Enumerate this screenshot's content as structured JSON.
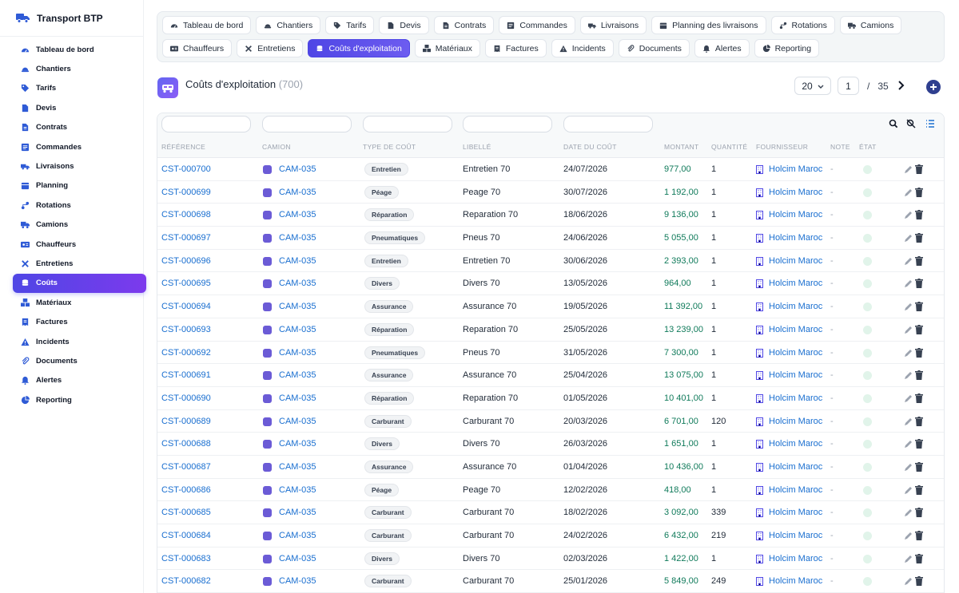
{
  "brand": {
    "title": "Transport BTP"
  },
  "sidebar": {
    "items": [
      {
        "label": "Tableau de bord",
        "icon": "gauge-icon"
      },
      {
        "label": "Chantiers",
        "icon": "hardhat-icon"
      },
      {
        "label": "Tarifs",
        "icon": "tag-icon"
      },
      {
        "label": "Devis",
        "icon": "document-icon"
      },
      {
        "label": "Contrats",
        "icon": "contract-icon"
      },
      {
        "label": "Commandes",
        "icon": "list-icon"
      },
      {
        "label": "Livraisons",
        "icon": "delivery-icon"
      },
      {
        "label": "Planning",
        "icon": "calendar-icon"
      },
      {
        "label": "Rotations",
        "icon": "route-icon"
      },
      {
        "label": "Camions",
        "icon": "truck-icon"
      },
      {
        "label": "Chauffeurs",
        "icon": "id-card-icon"
      },
      {
        "label": "Entretiens",
        "icon": "tools-icon"
      },
      {
        "label": "Coûts",
        "icon": "coins-icon",
        "active": true
      },
      {
        "label": "Matériaux",
        "icon": "cubes-icon"
      },
      {
        "label": "Factures",
        "icon": "invoice-icon"
      },
      {
        "label": "Incidents",
        "icon": "warning-icon"
      },
      {
        "label": "Documents",
        "icon": "paperclip-icon"
      },
      {
        "label": "Alertes",
        "icon": "bell-icon"
      },
      {
        "label": "Reporting",
        "icon": "pie-chart-icon"
      }
    ]
  },
  "tabs": [
    {
      "label": "Tableau de bord",
      "icon": "gauge-icon"
    },
    {
      "label": "Chantiers",
      "icon": "hardhat-icon"
    },
    {
      "label": "Tarifs",
      "icon": "tag-icon"
    },
    {
      "label": "Devis",
      "icon": "document-icon"
    },
    {
      "label": "Contrats",
      "icon": "contract-icon"
    },
    {
      "label": "Commandes",
      "icon": "list-icon"
    },
    {
      "label": "Livraisons",
      "icon": "delivery-icon"
    },
    {
      "label": "Planning des livraisons",
      "icon": "calendar-icon"
    },
    {
      "label": "Rotations",
      "icon": "route-icon"
    },
    {
      "label": "Camions",
      "icon": "truck-icon"
    },
    {
      "label": "Chauffeurs",
      "icon": "id-card-icon"
    },
    {
      "label": "Entretiens",
      "icon": "tools-icon"
    },
    {
      "label": "Coûts d'exploitation",
      "icon": "coins-icon",
      "active": true
    },
    {
      "label": "Matériaux",
      "icon": "cubes-icon"
    },
    {
      "label": "Factures",
      "icon": "invoice-icon"
    },
    {
      "label": "Incidents",
      "icon": "warning-icon"
    },
    {
      "label": "Documents",
      "icon": "paperclip-icon"
    },
    {
      "label": "Alertes",
      "icon": "bell-icon"
    },
    {
      "label": "Reporting",
      "icon": "pie-chart-icon"
    }
  ],
  "page": {
    "title": "Coûts d'exploitation",
    "count": "(700)"
  },
  "pager": {
    "page_size": "20",
    "current_page": "1",
    "separator": "/",
    "total_pages": "35"
  },
  "table": {
    "headers": [
      "RÉFÉRENCE",
      "CAMION",
      "TYPE DE COÛT",
      "LIBELLÉ",
      "DATE DU COÛT",
      "MONTANT",
      "QUANTITÉ",
      "FOURNISSEUR",
      "NOTE",
      "ÉTAT"
    ],
    "rows": [
      {
        "ref": "CST-000700",
        "truck": "CAM-035",
        "type": "Entretien",
        "label": "Entretien 70",
        "date": "24/07/2026",
        "amount": "977,00",
        "qty": "1",
        "supplier": "Holcim Maroc",
        "note": "-"
      },
      {
        "ref": "CST-000699",
        "truck": "CAM-035",
        "type": "Péage",
        "label": "Peage 70",
        "date": "30/07/2026",
        "amount": "1 192,00",
        "qty": "1",
        "supplier": "Holcim Maroc",
        "note": "-"
      },
      {
        "ref": "CST-000698",
        "truck": "CAM-035",
        "type": "Réparation",
        "label": "Reparation 70",
        "date": "18/06/2026",
        "amount": "9 136,00",
        "qty": "1",
        "supplier": "Holcim Maroc",
        "note": "-"
      },
      {
        "ref": "CST-000697",
        "truck": "CAM-035",
        "type": "Pneumatiques",
        "label": "Pneus 70",
        "date": "24/06/2026",
        "amount": "5 055,00",
        "qty": "1",
        "supplier": "Holcim Maroc",
        "note": "-"
      },
      {
        "ref": "CST-000696",
        "truck": "CAM-035",
        "type": "Entretien",
        "label": "Entretien 70",
        "date": "30/06/2026",
        "amount": "2 393,00",
        "qty": "1",
        "supplier": "Holcim Maroc",
        "note": "-"
      },
      {
        "ref": "CST-000695",
        "truck": "CAM-035",
        "type": "Divers",
        "label": "Divers 70",
        "date": "13/05/2026",
        "amount": "964,00",
        "qty": "1",
        "supplier": "Holcim Maroc",
        "note": "-"
      },
      {
        "ref": "CST-000694",
        "truck": "CAM-035",
        "type": "Assurance",
        "label": "Assurance 70",
        "date": "19/05/2026",
        "amount": "11 392,00",
        "qty": "1",
        "supplier": "Holcim Maroc",
        "note": "-"
      },
      {
        "ref": "CST-000693",
        "truck": "CAM-035",
        "type": "Réparation",
        "label": "Reparation 70",
        "date": "25/05/2026",
        "amount": "13 239,00",
        "qty": "1",
        "supplier": "Holcim Maroc",
        "note": "-"
      },
      {
        "ref": "CST-000692",
        "truck": "CAM-035",
        "type": "Pneumatiques",
        "label": "Pneus 70",
        "date": "31/05/2026",
        "amount": "7 300,00",
        "qty": "1",
        "supplier": "Holcim Maroc",
        "note": "-"
      },
      {
        "ref": "CST-000691",
        "truck": "CAM-035",
        "type": "Assurance",
        "label": "Assurance 70",
        "date": "25/04/2026",
        "amount": "13 075,00",
        "qty": "1",
        "supplier": "Holcim Maroc",
        "note": "-"
      },
      {
        "ref": "CST-000690",
        "truck": "CAM-035",
        "type": "Réparation",
        "label": "Reparation 70",
        "date": "01/05/2026",
        "amount": "10 401,00",
        "qty": "1",
        "supplier": "Holcim Maroc",
        "note": "-"
      },
      {
        "ref": "CST-000689",
        "truck": "CAM-035",
        "type": "Carburant",
        "label": "Carburant 70",
        "date": "20/03/2026",
        "amount": "6 701,00",
        "qty": "120",
        "supplier": "Holcim Maroc",
        "note": "-"
      },
      {
        "ref": "CST-000688",
        "truck": "CAM-035",
        "type": "Divers",
        "label": "Divers 70",
        "date": "26/03/2026",
        "amount": "1 651,00",
        "qty": "1",
        "supplier": "Holcim Maroc",
        "note": "-"
      },
      {
        "ref": "CST-000687",
        "truck": "CAM-035",
        "type": "Assurance",
        "label": "Assurance 70",
        "date": "01/04/2026",
        "amount": "10 436,00",
        "qty": "1",
        "supplier": "Holcim Maroc",
        "note": "-"
      },
      {
        "ref": "CST-000686",
        "truck": "CAM-035",
        "type": "Péage",
        "label": "Peage 70",
        "date": "12/02/2026",
        "amount": "418,00",
        "qty": "1",
        "supplier": "Holcim Maroc",
        "note": "-"
      },
      {
        "ref": "CST-000685",
        "truck": "CAM-035",
        "type": "Carburant",
        "label": "Carburant 70",
        "date": "18/02/2026",
        "amount": "3 092,00",
        "qty": "339",
        "supplier": "Holcim Maroc",
        "note": "-"
      },
      {
        "ref": "CST-000684",
        "truck": "CAM-035",
        "type": "Carburant",
        "label": "Carburant 70",
        "date": "24/02/2026",
        "amount": "6 432,00",
        "qty": "219",
        "supplier": "Holcim Maroc",
        "note": "-"
      },
      {
        "ref": "CST-000683",
        "truck": "CAM-035",
        "type": "Divers",
        "label": "Divers 70",
        "date": "02/03/2026",
        "amount": "1 422,00",
        "qty": "1",
        "supplier": "Holcim Maroc",
        "note": "-"
      },
      {
        "ref": "CST-000682",
        "truck": "CAM-035",
        "type": "Carburant",
        "label": "Carburant 70",
        "date": "25/01/2026",
        "amount": "5 849,00",
        "qty": "249",
        "supplier": "Holcim Maroc",
        "note": "-"
      }
    ]
  },
  "colors": {
    "accent": "#4f46e5",
    "link": "#1a6fd0",
    "amount": "#0f7a5a"
  }
}
